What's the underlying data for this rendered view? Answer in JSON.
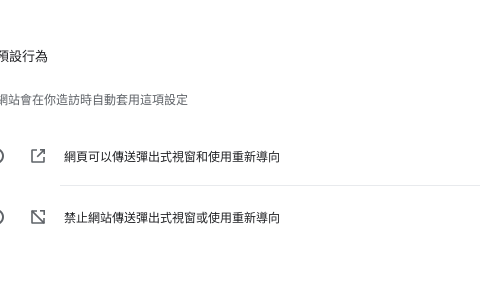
{
  "default_behavior": {
    "title": "預設行為",
    "description": "網站會在你造訪時自動套用這項設定",
    "options": [
      {
        "label": "網頁可以傳送彈出式視窗和使用重新導向",
        "icon": "open-in-new-icon"
      },
      {
        "label": "禁止網站傳送彈出式視窗或使用重新導向",
        "icon": "popup-blocked-icon"
      }
    ]
  }
}
